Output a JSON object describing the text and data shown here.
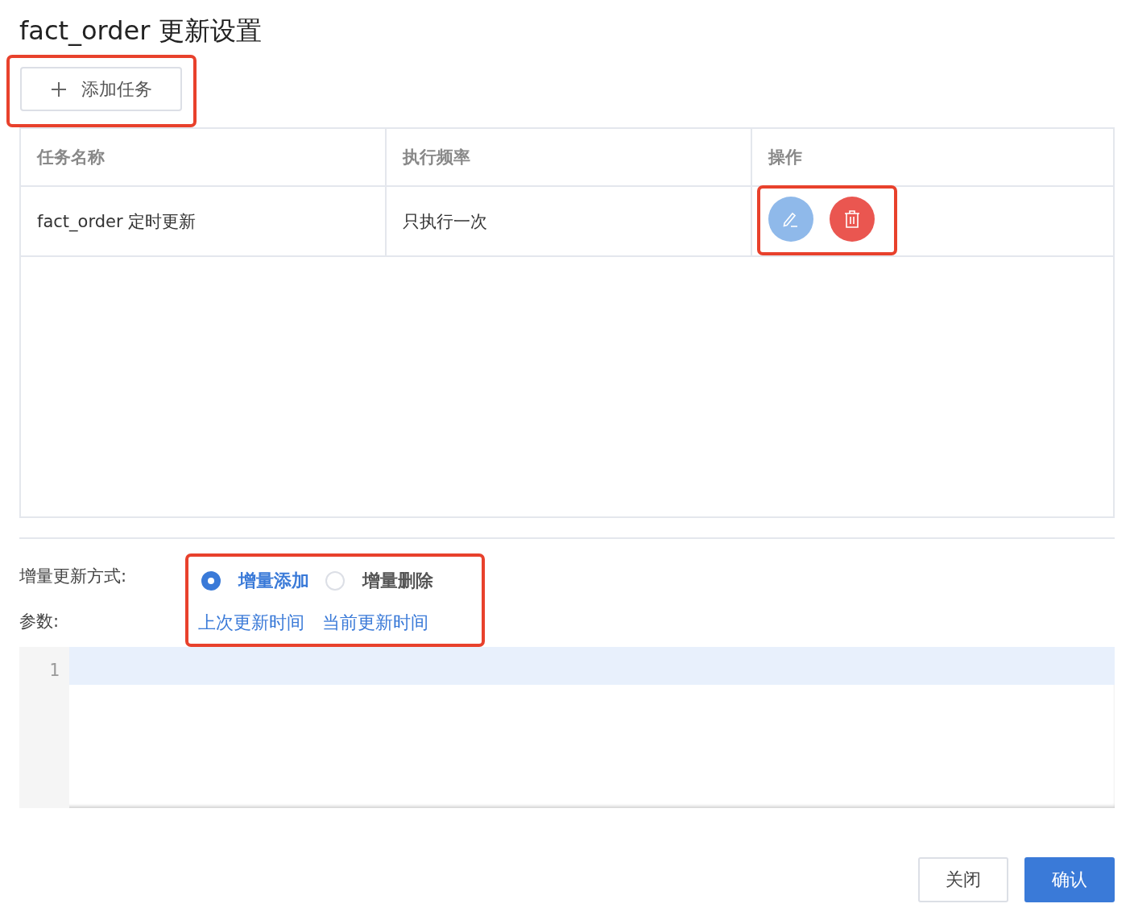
{
  "title": "fact_order 更新设置",
  "add_button": {
    "label": "添加任务"
  },
  "table": {
    "columns": [
      "任务名称",
      "执行频率",
      "操作"
    ],
    "rows": [
      {
        "name": "fact_order 定时更新",
        "frequency": "只执行一次"
      }
    ]
  },
  "update_mode": {
    "label": "增量更新方式:",
    "options": [
      {
        "label": "增量添加",
        "selected": true
      },
      {
        "label": "增量删除",
        "selected": false
      }
    ]
  },
  "params": {
    "label": "参数:",
    "variables": [
      "上次更新时间",
      "当前更新时间"
    ]
  },
  "editor": {
    "line_numbers": [
      "1"
    ]
  },
  "buttons": [
    {
      "label": "关闭",
      "kind": "default"
    },
    {
      "label": "确认",
      "kind": "primary"
    }
  ]
}
